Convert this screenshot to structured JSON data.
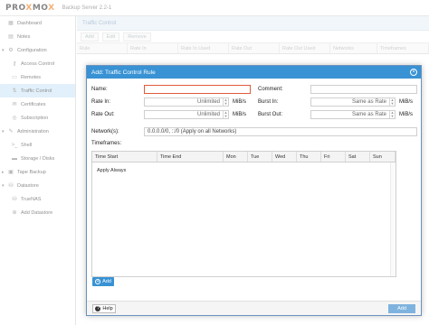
{
  "app": {
    "logo_a": "PRO",
    "logo_x": "X",
    "logo_b": "MO",
    "logo_c": "X",
    "version": "Backup Server 2.2-1"
  },
  "sidebar": {
    "items": [
      {
        "label": "Dashboard",
        "icon": "dashboard-icon"
      },
      {
        "label": "Notes",
        "icon": "notes-icon"
      },
      {
        "label": "Configuration",
        "icon": "gear-icon"
      },
      {
        "label": "Access Control",
        "icon": "key-icon"
      },
      {
        "label": "Remotes",
        "icon": "server-icon"
      },
      {
        "label": "Traffic Control",
        "icon": "traffic-icon"
      },
      {
        "label": "Certificates",
        "icon": "certificate-icon"
      },
      {
        "label": "Subscription",
        "icon": "support-icon"
      },
      {
        "label": "Administration",
        "icon": "wrench-icon"
      },
      {
        "label": "Shell",
        "icon": "terminal-icon"
      },
      {
        "label": "Storage / Disks",
        "icon": "hdd-icon"
      },
      {
        "label": "Tape Backup",
        "icon": "tape-icon"
      },
      {
        "label": "Datastore",
        "icon": "database-icon"
      },
      {
        "label": "TrueNAS",
        "icon": "database-icon"
      },
      {
        "label": "Add Datastore",
        "icon": "plus-circle-icon"
      }
    ]
  },
  "content": {
    "title": "Traffic Control",
    "toolbar": {
      "add": "Add",
      "edit": "Edit",
      "remove": "Remove"
    },
    "columns": [
      "Rule",
      "Rate In",
      "Rate In Used",
      "Rate Out",
      "Rate Out Used",
      "Networks",
      "Timeframes"
    ]
  },
  "dialog": {
    "title": "Add: Traffic Control Rule",
    "name_label": "Name:",
    "name_value": "",
    "comment_label": "Comment:",
    "comment_value": "",
    "rate_in_label": "Rate In:",
    "rate_in_value": "Unlimited",
    "rate_in_unit": "MiB/s",
    "burst_in_label": "Burst In:",
    "burst_in_value": "Same as Rate",
    "burst_in_unit": "MiB/s",
    "rate_out_label": "Rate Out:",
    "rate_out_value": "Unlimited",
    "rate_out_unit": "MiB/s",
    "burst_out_label": "Burst Out:",
    "burst_out_value": "Same as Rate",
    "burst_out_unit": "MiB/s",
    "networks_label": "Network(s):",
    "networks_value": "0.0.0.0/0, ::/0 (Apply on all Networks)",
    "timeframes_label": "Timeframes:",
    "tf_columns": [
      "Time Start",
      "Time End",
      "Mon",
      "Tue",
      "Wed",
      "Thu",
      "Fri",
      "Sat",
      "Sun"
    ],
    "tf_empty": "Apply Always",
    "add_button": "Add",
    "help_button": "Help",
    "submit_button": "Add"
  }
}
